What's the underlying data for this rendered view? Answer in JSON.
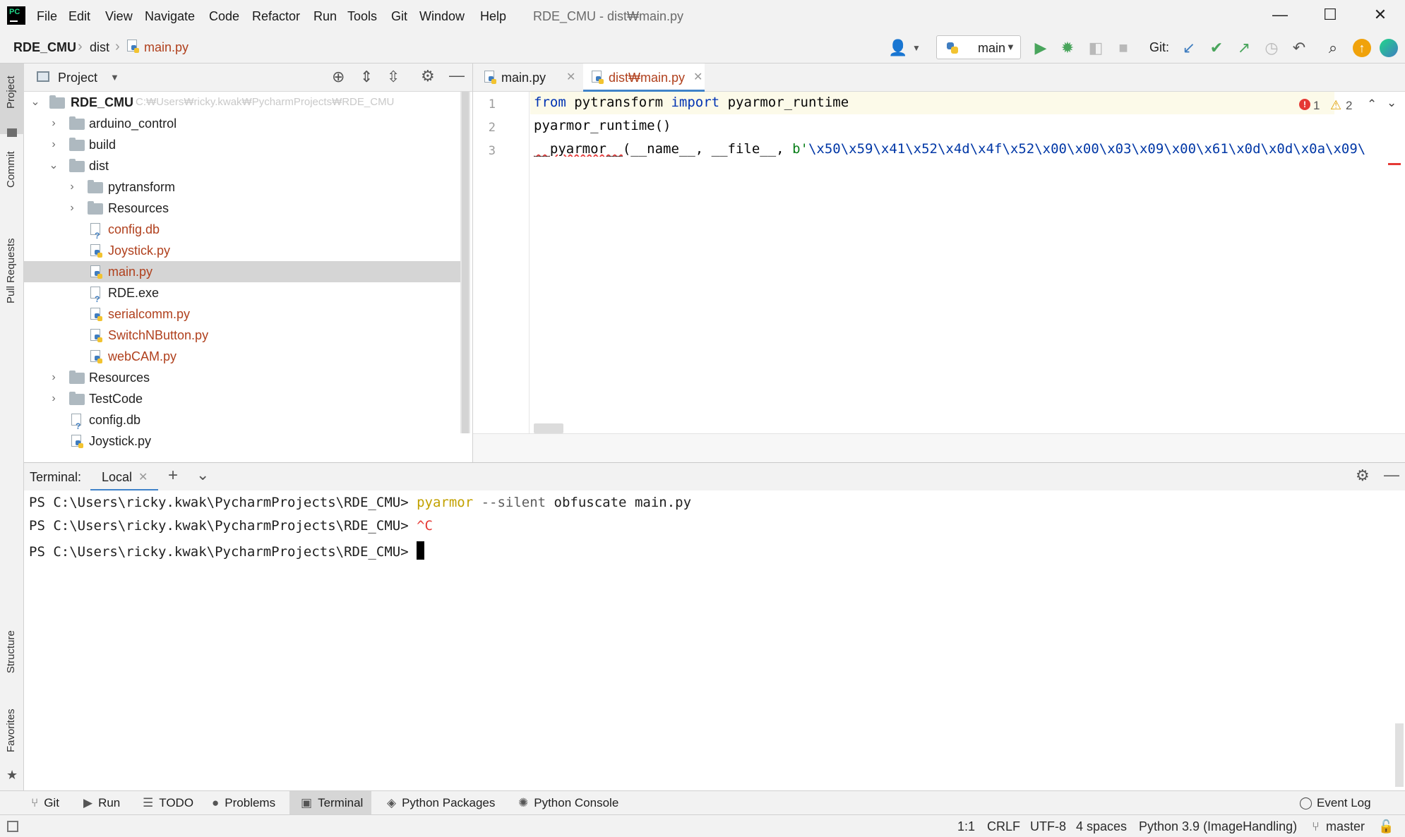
{
  "window": {
    "title": "RDE_CMU - dist₩main.py",
    "controls": {
      "minimize": "—",
      "maximize": "☐",
      "close": "✕"
    }
  },
  "menu": [
    "File",
    "Edit",
    "View",
    "Navigate",
    "Code",
    "Refactor",
    "Run",
    "Tools",
    "Git",
    "Window",
    "Help"
  ],
  "breadcrumb": {
    "project": "RDE_CMU",
    "folder": "dist",
    "file": "main.py"
  },
  "toolbar": {
    "run_config": "main",
    "git_label": "Git:",
    "icons": [
      "user-icon",
      "run-icon",
      "debug-icon",
      "coverage-icon",
      "stop-icon",
      "git-update-icon",
      "git-commit-icon",
      "git-push-icon",
      "history-icon",
      "rollback-icon",
      "search-icon",
      "ide-update-icon",
      "toolbox-icon"
    ]
  },
  "left_stripe": {
    "project": "Project",
    "commit": "Commit",
    "pull_requests": "Pull Requests",
    "structure": "Structure",
    "favorites": "Favorites"
  },
  "project_panel": {
    "title": "Project",
    "root": {
      "label": "RDE_CMU",
      "path": "C:₩Users₩ricky.kwak₩PycharmProjects₩RDE_CMU"
    },
    "items": [
      {
        "label": "arduino_control",
        "type": "folder",
        "modified": false
      },
      {
        "label": "build",
        "type": "folder",
        "modified": false
      },
      {
        "label": "dist",
        "type": "folder",
        "modified": false
      },
      {
        "label": "pytransform",
        "type": "package",
        "modified": false
      },
      {
        "label": "Resources",
        "type": "folder",
        "modified": false
      },
      {
        "label": "config.db",
        "type": "unknown",
        "modified": true
      },
      {
        "label": "Joystick.py",
        "type": "python",
        "modified": true
      },
      {
        "label": "main.py",
        "type": "python",
        "modified": true
      },
      {
        "label": "RDE.exe",
        "type": "unknown",
        "modified": false
      },
      {
        "label": "serialcomm.py",
        "type": "python",
        "modified": true
      },
      {
        "label": "SwitchNButton.py",
        "type": "python",
        "modified": true
      },
      {
        "label": "webCAM.py",
        "type": "python",
        "modified": true
      },
      {
        "label": "Resources",
        "type": "folder",
        "modified": false
      },
      {
        "label": "TestCode",
        "type": "folder",
        "modified": false
      },
      {
        "label": "config.db",
        "type": "unknown",
        "modified": false
      },
      {
        "label": "Joystick.py",
        "type": "python",
        "modified": false
      }
    ]
  },
  "editor": {
    "tabs": [
      {
        "label": "main.py",
        "active": false
      },
      {
        "label": "dist₩main.py",
        "active": true
      }
    ],
    "line_numbers": [
      "1",
      "2",
      "3"
    ],
    "lines": {
      "l1_from": "from",
      "l1_mod": " pytransform ",
      "l1_import": "import",
      "l1_name": " pyarmor_runtime",
      "l2": "pyarmor_runtime()",
      "l3_func": "__pyarmor__",
      "l3_args": "(__name__, __file__, ",
      "l3_prefix": "b'",
      "l3_bytes": "\\x50\\x59\\x41\\x52\\x4d\\x4f\\x52\\x00\\x00\\x03\\x09\\x00\\x61\\x0d\\x0d\\x0a\\x09\\"
    },
    "inspections": {
      "errors": "1",
      "warnings": "2"
    }
  },
  "terminal": {
    "title": "Terminal:",
    "tab": "Local",
    "prompt": "PS C:\\Users\\ricky.kwak\\PycharmProjects\\RDE_CMU> ",
    "lines": [
      {
        "cmd": "pyarmor",
        "args": " --silent",
        "rest": " obfuscate main.py"
      },
      {
        "ctrl": "^C"
      },
      {
        "cursor": true
      }
    ]
  },
  "tool_windows": [
    "Git",
    "Run",
    "TODO",
    "Problems",
    "Terminal",
    "Python Packages",
    "Python Console"
  ],
  "event_log": "Event Log",
  "status": {
    "position": "1:1",
    "line_sep": "CRLF",
    "encoding": "UTF-8",
    "indent": "4 spaces",
    "interpreter": "Python 3.9 (ImageHandling)",
    "branch": "master"
  },
  "colors": {
    "accent": "#4083c9",
    "modified_file": "#b0401d",
    "keyword": "#0033b3",
    "bytes": "#0037a6",
    "terminal_cmd": "#c2a100",
    "error": "#e53935"
  }
}
